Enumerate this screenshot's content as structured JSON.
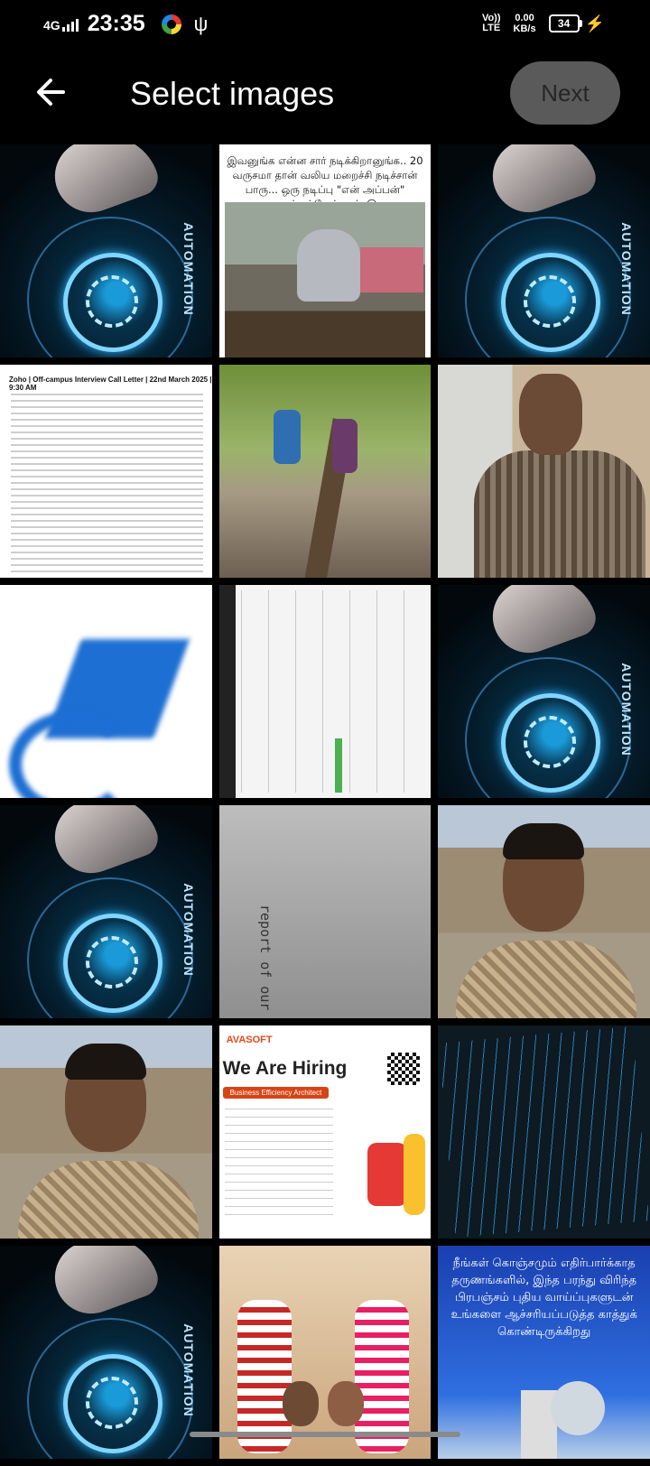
{
  "status": {
    "network": "4G",
    "time": "23:35",
    "volte": [
      "Vo))",
      "LTE"
    ],
    "speed_value": "0.00",
    "speed_unit": "KB/s",
    "battery": "34"
  },
  "appbar": {
    "title": "Select images",
    "next_label": "Next"
  },
  "thumbnails": {
    "automation_word": "AUTOMATION",
    "meme_text": "இவனுங்க என்ன சார் நடிக்கிறானுங்க.. 20 வருசமா தான் வலிய மறைச்சி நடிச்சான் பாரு... ஒரு நடிப்பு \"என் அப்பன்\" அசந்துட்டேன் சார். 😑",
    "doc_title": "Zoho | Off-campus Interview Call Letter | 22nd March 2025 | 9:30 AM",
    "paper_text": "report of our project in ca\n-- logger \"trx;logfileName=TestRes",
    "hiring_brand": "AVASOFT",
    "hiring_title": "We Are Hiring",
    "hiring_role": "Business Efficiency Architect",
    "quote_text": "நீங்கள் கொஞ்சமும் எதிர்பார்க்காத தருணங்களில், இந்த பரந்து விரிந்த பிரபஞ்சம் புதிய வாய்ப்புகளுடன் உங்களை ஆச்சரியப்படுத்த காத்துக் கொண்டிருக்கிறது"
  },
  "colors": {
    "background": "#000000",
    "next_button_bg": "#5a5a5a",
    "next_button_text": "#262626"
  }
}
